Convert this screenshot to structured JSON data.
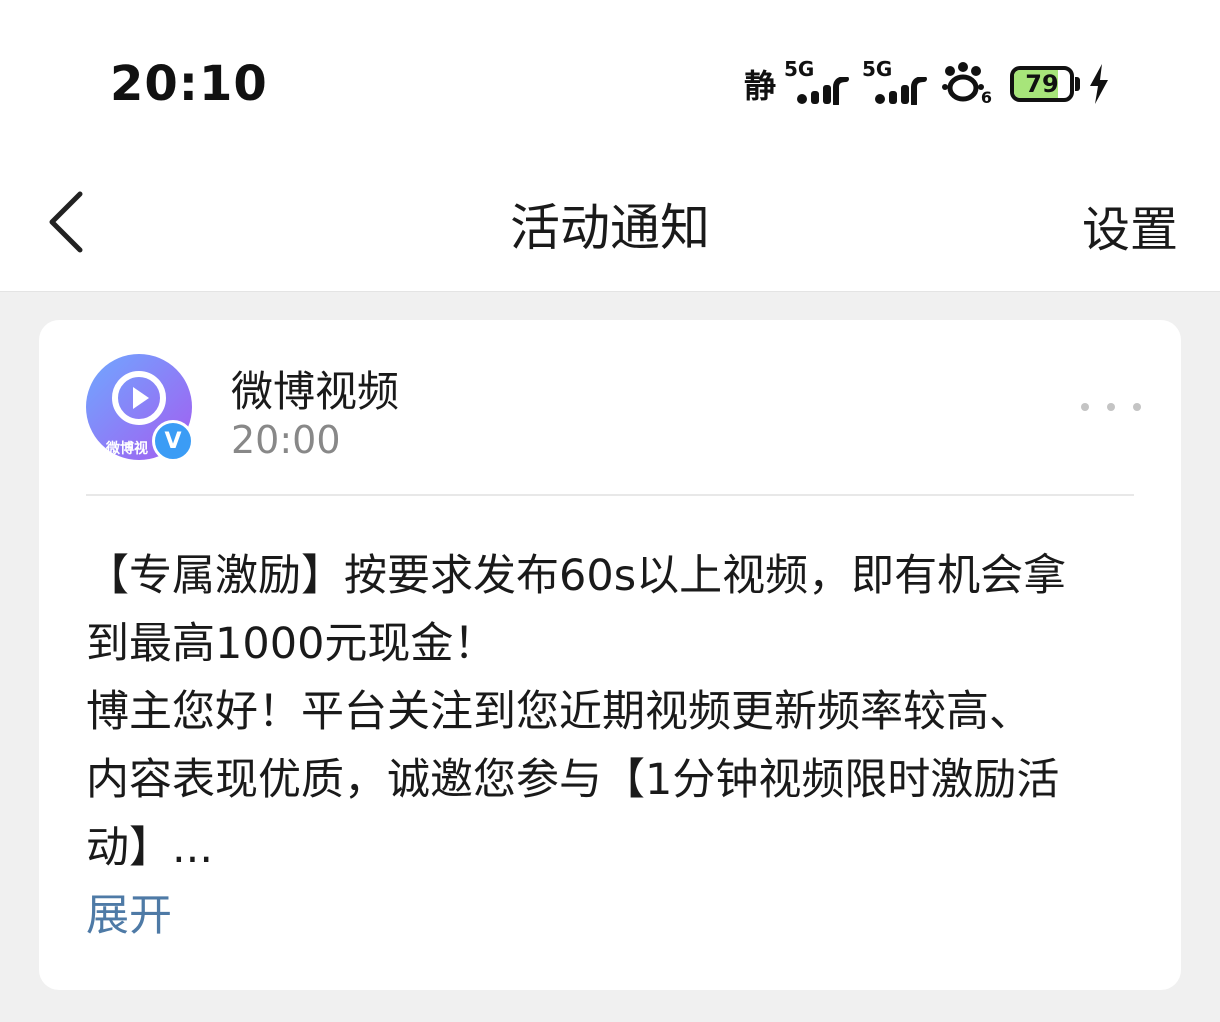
{
  "status_bar": {
    "time": "20:10",
    "mode_text": "静",
    "network_1": "5G",
    "network_2": "5G",
    "paw_sub": "6",
    "battery_level": "79",
    "battery_fraction": 0.79
  },
  "nav": {
    "title": "活动通知",
    "settings_label": "设置"
  },
  "notification": {
    "sender": "微博视频",
    "time": "20:00",
    "avatar_text": "微博视",
    "verified_mark": "V",
    "lines": [
      "【专属激励】按要求发布60s以上视频，即有机会拿",
      "到最高1000元现金！",
      "博主您好！平台关注到您近期视频更新频率较高、",
      "内容表现优质，诚邀您参与【1分钟视频限时激励活",
      "动】..."
    ],
    "expand_label": "展开"
  },
  "colors": {
    "accent_link": "#4e7aa6",
    "page_bg": "#f0f0f0",
    "avatar_gradient_start": "#6fa8ff",
    "avatar_gradient_end": "#a45cf0",
    "verified_badge": "#3b9cf5",
    "battery_fill": "#a7e57a"
  }
}
